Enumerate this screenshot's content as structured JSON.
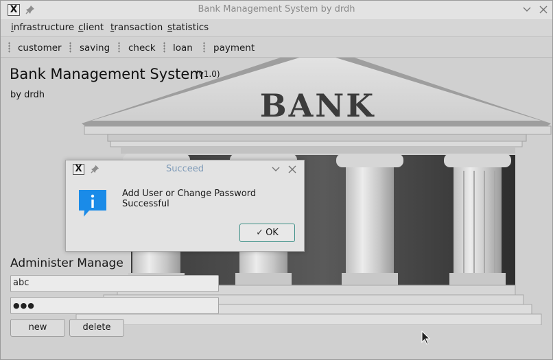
{
  "window": {
    "title": "Bank Management System by drdh"
  },
  "menu": {
    "items": [
      {
        "first": "i",
        "rest": "nfrastructure"
      },
      {
        "first": "c",
        "rest": "lient"
      },
      {
        "first": "t",
        "rest": "ransaction"
      },
      {
        "first": "s",
        "rest": "tatistics"
      }
    ]
  },
  "toolbar": {
    "items": [
      "customer",
      "saving",
      "check",
      "loan",
      "payment"
    ]
  },
  "main": {
    "title": "Bank Management System",
    "version": "(v1.0)",
    "author": "by drdh",
    "banner_text": "BANK"
  },
  "admin": {
    "heading": "Administer Manage",
    "username_value": "abc",
    "password_dots": "●●●",
    "new_label": "new",
    "delete_label": "delete"
  },
  "dialog": {
    "title": "Succeed",
    "message": "Add User or Change Password Successful",
    "ok_label": "OK",
    "icon": "info-icon",
    "accent_color": "#3b8f86",
    "info_color": "#1a8be8"
  }
}
